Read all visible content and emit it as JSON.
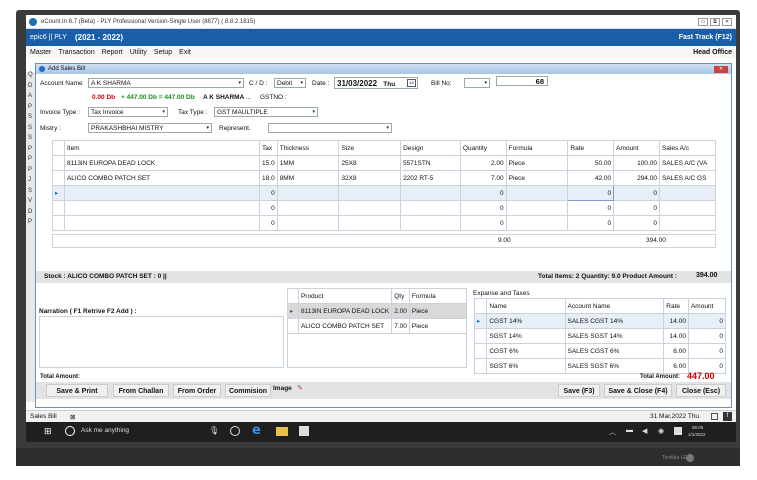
{
  "window": {
    "title": "eCount.In 8.7 (Beta) - PLY Professional Version-Single User (8877) ( 8.8.2.1815)",
    "buttons": [
      "▭",
      "⧉",
      "✕"
    ]
  },
  "header": {
    "company": "epic6 || PLY",
    "fy": "(2021 - 2022)",
    "fast_track": "Fast Track (F12)"
  },
  "menu": {
    "items": [
      "Master",
      "Transaction",
      "Report",
      "Utility",
      "Setup",
      "Exit"
    ],
    "branch": "Head Office"
  },
  "left_strip": [
    "Q",
    "D",
    "A",
    "P",
    "S",
    "S",
    "S",
    "P",
    "P",
    "P",
    "J",
    "S",
    "V",
    "D",
    "P"
  ],
  "dialog": {
    "title": "Add Sales Bill",
    "account_label": "Account Name",
    "account_value": "A K SHARMA",
    "cd_label": "C / D :",
    "cd_value": "Debit",
    "date_label": "Date :",
    "date_value": "31/03/2022",
    "day_value": "Thu",
    "billno_label": "Bill No:",
    "billno_value": "68",
    "balance_red": "0.00 Db",
    "balance_green": "+ 447.00 Db = 447.00 Db",
    "account_name2": "A K SHARMA",
    "dots": "...",
    "gstno_label": "GSTNO :",
    "invoice_label": "Invoice Type :",
    "invoice_value": "Tax Invoice",
    "taxtype_label": "Tax Type :",
    "taxtype_value": "GST MAULTIPLE",
    "mistry_label": "Mistry :",
    "mistry_value": "PRAKASHBHAI MISTRY",
    "represent_label": "Represent.",
    "item_headers": [
      "Item",
      "Tax",
      "Thickness",
      "Size",
      "Design",
      "Quantity",
      "Formula",
      "Rate",
      "Amount",
      "Sales A/c"
    ],
    "items": [
      [
        "8113IN EUROPA DEAD LOCK",
        "15.0",
        "1MM",
        "25X8",
        "5571STN",
        "2.00",
        "Piece",
        "50.00",
        "100.00",
        "SALES A/C (VA"
      ],
      [
        "ALICO COMBO PATCH SET",
        "18.0",
        "8MM",
        "32X8",
        "2202 RT-5",
        "7.00",
        "Piece",
        "42.00",
        "294.00",
        "SALES A/C GS"
      ],
      [
        "",
        "0",
        "",
        "",
        "",
        "0",
        "",
        "0",
        "0",
        ""
      ],
      [
        "",
        "0",
        "",
        "",
        "",
        "0",
        "",
        "0",
        "0",
        ""
      ],
      [
        "",
        "0",
        "",
        "",
        "",
        "0",
        "",
        "0",
        "0",
        ""
      ]
    ],
    "total_qty": "9.00",
    "total_amount": "394.00",
    "stock_text": "Stock : ALICO COMBO PATCH SET : 0 ||",
    "summary_text": "Total Items:  2  Quantity:  9.0  Product Amount :",
    "summary_amount": "394.00",
    "narration_label": "Narration ( F1 Retrive F2 Add ) :",
    "product_headers": [
      "Product",
      "Qty",
      "Formula"
    ],
    "products": [
      [
        "8113IN EUROPA DEAD LOCK",
        "2.00",
        "Piece"
      ],
      [
        "ALICO COMBO PATCH SET",
        "7.00",
        "Piece"
      ]
    ],
    "expense_title": "Expanse and Taxes",
    "expense_headers": [
      "Name",
      "Account Name",
      "Rate",
      "Amount"
    ],
    "expenses": [
      [
        "CGST 14%",
        "SALES CGST 14%",
        "14.00",
        "0"
      ],
      [
        "SGST 14%",
        "SALES SGST 14%",
        "14.00",
        "0"
      ],
      [
        "CGST 6%",
        "SALES CGST 6%",
        "6.00",
        "0"
      ],
      [
        "SGST 6%",
        "SALES SGST 6%",
        "6.00",
        "0"
      ]
    ],
    "total_amount_label": "Total Amount:",
    "total_amount_label2": "Total Amount:",
    "grand_total": "447.00",
    "buttons": {
      "save_print": "Save & Print",
      "from_challan": "From Challan",
      "from_order": "From Order",
      "commission": "Commision",
      "image": "Image",
      "save": "Save (F3)",
      "save_close": "Save & Close (F4)",
      "close": "Close (Esc)"
    }
  },
  "statusbar": {
    "tab": "Sales Bill",
    "tab_close": "⊠",
    "date": "31 Mar,2022 Thu"
  },
  "taskbar": {
    "search": "Ask me anything",
    "time": "06:00",
    "date": "1/1/2022"
  },
  "monitor_brand": "Toshiba LED"
}
